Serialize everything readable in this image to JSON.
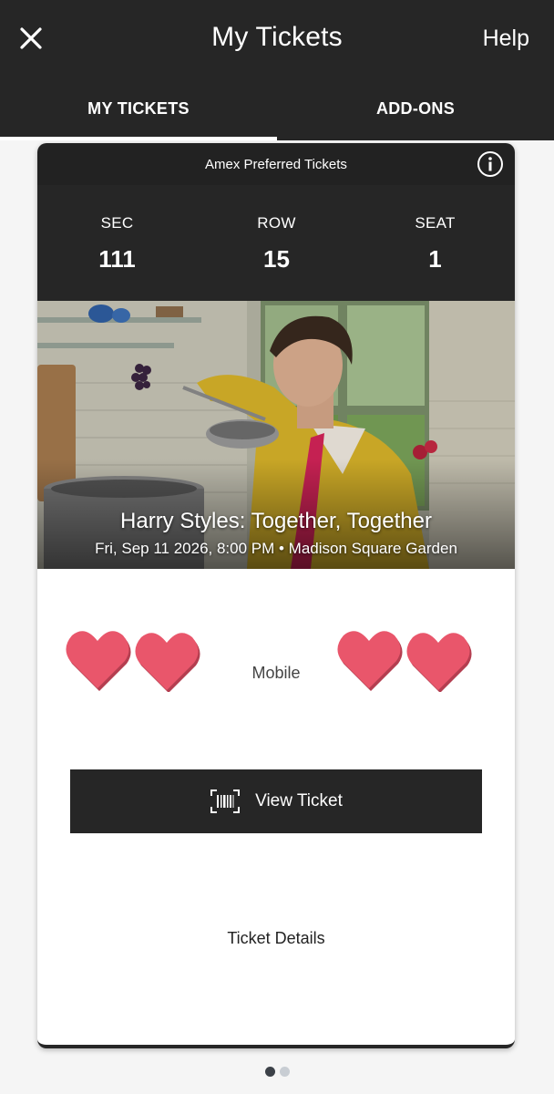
{
  "app_bar": {
    "title": "My Tickets",
    "help_label": "Help",
    "close_icon": "close-icon"
  },
  "tabs": [
    {
      "label": "MY TICKETS",
      "active": true
    },
    {
      "label": "ADD-ONS",
      "active": false
    }
  ],
  "ticket": {
    "type_label": "Amex Preferred Tickets",
    "info_icon": "info-icon",
    "section_label": "SEC",
    "section_value": "111",
    "row_label": "ROW",
    "row_value": "15",
    "seat_label": "SEAT",
    "seat_value": "1",
    "event_name": "Harry Styles: Together, Together",
    "event_meta": "Fri, Sep 11 2026, 8:00 PM • Madison Square Garden",
    "delivery_label": "Mobile",
    "view_button_label": "View Ticket",
    "view_button_icon": "barcode-icon",
    "details_label": "Ticket Details"
  },
  "pagination": {
    "total": 2,
    "current": 1
  },
  "colors": {
    "bar_background": "#262626",
    "heart": "#e9566b",
    "page_background": "#f5f5f5"
  }
}
